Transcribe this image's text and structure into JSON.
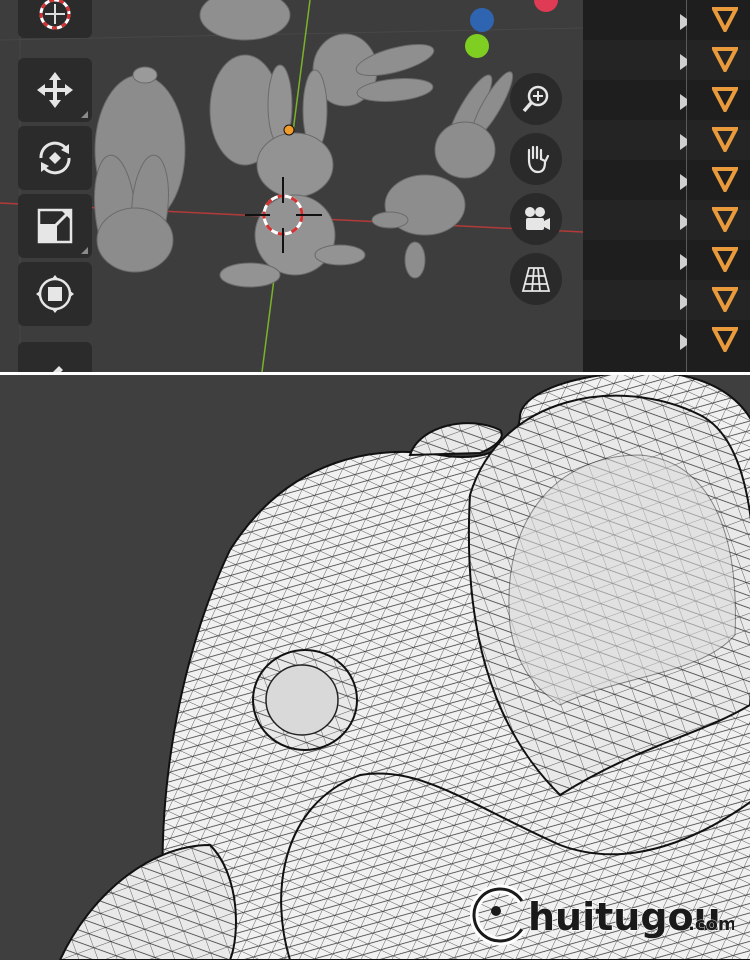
{
  "viewport": {
    "background": "#3d3d3d",
    "axis_x_color": "#b33a3a",
    "axis_y_color": "#7ab22a",
    "gizmo": {
      "blue_dot": "#2f65b0",
      "green_dot": "#7fcf22",
      "red_dot": "#e03b55"
    }
  },
  "toolbar": {
    "tools": [
      {
        "name": "cursor-tool",
        "icon": "cursor-icon"
      },
      {
        "name": "move-tool",
        "icon": "move-icon"
      },
      {
        "name": "rotate-tool",
        "icon": "rotate-icon"
      },
      {
        "name": "scale-tool",
        "icon": "scale-icon"
      },
      {
        "name": "transform-tool",
        "icon": "transform-icon"
      },
      {
        "name": "annotate-tool",
        "icon": "pencil-icon"
      }
    ]
  },
  "navigation": {
    "buttons": [
      {
        "name": "zoom-button",
        "icon": "zoom-icon"
      },
      {
        "name": "pan-button",
        "icon": "hand-icon"
      },
      {
        "name": "camera-view-button",
        "icon": "camera-icon"
      },
      {
        "name": "perspective-toggle-button",
        "icon": "grid-icon"
      }
    ]
  },
  "timeline": {
    "keyframe_color": "#e89a3c",
    "keyframe_count": 9
  },
  "watermark": {
    "brand_main": "huitugou",
    "brand_suffix": ".com"
  }
}
